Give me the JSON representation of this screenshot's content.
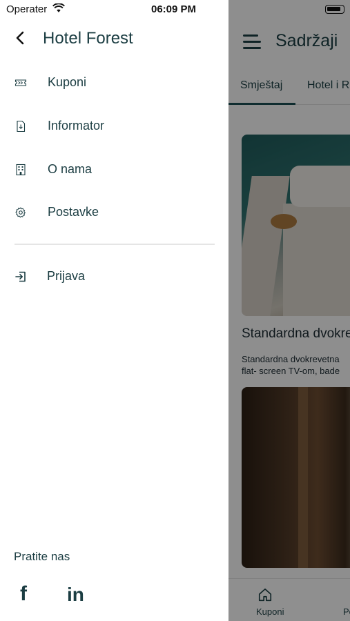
{
  "status_bar": {
    "carrier": "Operater",
    "time": "06:09 PM"
  },
  "drawer": {
    "title": "Hotel Forest",
    "menu": [
      {
        "label": "Kuponi",
        "icon": "ticket-icon"
      },
      {
        "label": "Informator",
        "icon": "document-download-icon"
      },
      {
        "label": "O nama",
        "icon": "building-icon"
      },
      {
        "label": "Postavke",
        "icon": "gear-icon"
      }
    ],
    "login": {
      "label": "Prijava",
      "icon": "login-icon"
    },
    "follow_label": "Pratite nas",
    "social": [
      {
        "glyph": "f",
        "icon": "facebook-icon"
      },
      {
        "glyph": "in",
        "icon": "linkedin-icon"
      }
    ]
  },
  "background_app": {
    "title": "Sadržaji",
    "tabs": [
      "Smještaj",
      "Hotel i R"
    ],
    "cards": [
      {
        "title": "Standardna dvokre",
        "description_line1": "Standardna dvokrevetna",
        "description_line2": "flat- screen TV-om, bade"
      }
    ],
    "bottom_nav": [
      "Kuponi",
      "Po"
    ]
  },
  "colors": {
    "primary": "#1b3d42",
    "overlay": "rgba(0,0,0,0.42)",
    "divider": "#e5e5e5"
  }
}
